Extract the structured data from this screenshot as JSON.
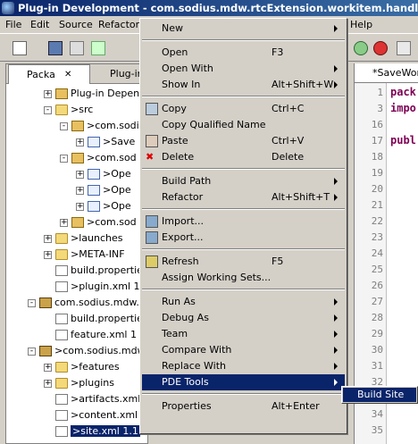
{
  "window": {
    "title": "Plug-in Development - com.sodius.mdw.rtcExtension.workitem.handler/src/com"
  },
  "menubar": [
    "File",
    "Edit",
    "Source",
    "Refactor",
    "Help"
  ],
  "explorer": {
    "tabs": [
      "Packa",
      "Plug-in"
    ],
    "tree": [
      {
        "label": "Plug-in Depen",
        "indent": 0,
        "icon": "pkg",
        "expander": "+"
      },
      {
        "label": ">src",
        "indent": 0,
        "icon": "folder",
        "expander": "-"
      },
      {
        "label": ">com.sodi",
        "indent": 1,
        "icon": "pkg",
        "expander": "-"
      },
      {
        "label": ">Save",
        "indent": 2,
        "icon": "java",
        "expander": "+"
      },
      {
        "label": ">com.sod",
        "indent": 1,
        "icon": "pkg",
        "expander": "-"
      },
      {
        "label": ">Ope",
        "indent": 2,
        "icon": "java",
        "expander": "+"
      },
      {
        "label": ">Ope",
        "indent": 2,
        "icon": "java",
        "expander": "+"
      },
      {
        "label": ">Ope",
        "indent": 2,
        "icon": "java",
        "expander": "+"
      },
      {
        "label": ">com.sod",
        "indent": 1,
        "icon": "pkg",
        "expander": "+"
      },
      {
        "label": ">launches",
        "indent": 0,
        "icon": "folder",
        "expander": "+"
      },
      {
        "label": ">META-INF",
        "indent": 0,
        "icon": "folder",
        "expander": "+"
      },
      {
        "label": "build.propertie",
        "indent": 0,
        "icon": "file",
        "expander": ""
      },
      {
        "label": ">plugin.xml  1",
        "indent": 0,
        "icon": "file",
        "expander": ""
      },
      {
        "label": "com.sodius.mdw.r",
        "indent": -1,
        "icon": "project",
        "expander": "-"
      },
      {
        "label": "build.propertie",
        "indent": 0,
        "icon": "file",
        "expander": ""
      },
      {
        "label": "feature.xml  1",
        "indent": 0,
        "icon": "file",
        "expander": ""
      },
      {
        "label": ">com.sodius.mdw",
        "indent": -1,
        "icon": "project",
        "expander": "-"
      },
      {
        "label": ">features",
        "indent": 0,
        "icon": "folder",
        "expander": "+"
      },
      {
        "label": ">plugins",
        "indent": 0,
        "icon": "folder",
        "expander": "+"
      },
      {
        "label": ">artifacts.xml",
        "indent": 0,
        "icon": "file",
        "expander": ""
      },
      {
        "label": ">content.xml",
        "indent": 0,
        "icon": "file",
        "expander": ""
      },
      {
        "label": ">site.xml  1.1",
        "indent": 0,
        "icon": "file",
        "expander": "",
        "selected": true
      }
    ]
  },
  "editor": {
    "tab": "*SaveWor",
    "lines": [
      {
        "no": "1",
        "code": "pack"
      },
      {
        "no": "3",
        "code": "impo"
      },
      {
        "no": "16",
        "code": ""
      },
      {
        "no": "17",
        "code": "publ"
      },
      {
        "no": "18",
        "code": ""
      },
      {
        "no": "19",
        "code": ""
      },
      {
        "no": "20",
        "code": ""
      },
      {
        "no": "21",
        "code": ""
      },
      {
        "no": "22",
        "code": ""
      },
      {
        "no": "23",
        "code": ""
      },
      {
        "no": "24",
        "code": ""
      },
      {
        "no": "25",
        "code": ""
      },
      {
        "no": "26",
        "code": ""
      },
      {
        "no": "27",
        "code": ""
      },
      {
        "no": "28",
        "code": ""
      },
      {
        "no": "29",
        "code": ""
      },
      {
        "no": "30",
        "code": ""
      },
      {
        "no": "31",
        "code": ""
      },
      {
        "no": "32",
        "code": ""
      },
      {
        "no": "33",
        "code": ""
      },
      {
        "no": "34",
        "code": ""
      },
      {
        "no": "35",
        "code": ""
      }
    ]
  },
  "context_menu": {
    "items": [
      {
        "label": "New",
        "key": "",
        "submenu": true
      },
      {
        "sep": true
      },
      {
        "label": "Open",
        "key": "F3"
      },
      {
        "label": "Open With",
        "key": "",
        "submenu": true
      },
      {
        "label": "Show In",
        "key": "Alt+Shift+W",
        "submenu": true
      },
      {
        "sep": true
      },
      {
        "label": "Copy",
        "key": "Ctrl+C",
        "icon": "copy-icon"
      },
      {
        "label": "Copy Qualified Name",
        "key": ""
      },
      {
        "label": "Paste",
        "key": "Ctrl+V",
        "icon": "paste-icon"
      },
      {
        "label": "Delete",
        "key": "Delete",
        "icon": "delete-icon"
      },
      {
        "sep": true
      },
      {
        "label": "Build Path",
        "key": "",
        "submenu": true
      },
      {
        "label": "Refactor",
        "key": "Alt+Shift+T",
        "submenu": true
      },
      {
        "sep": true
      },
      {
        "label": "Import...",
        "key": "",
        "icon": "import-icon"
      },
      {
        "label": "Export...",
        "key": "",
        "icon": "export-icon"
      },
      {
        "sep": true
      },
      {
        "label": "Refresh",
        "key": "F5",
        "icon": "refresh-icon"
      },
      {
        "label": "Assign Working Sets...",
        "key": ""
      },
      {
        "sep": true
      },
      {
        "label": "Run As",
        "key": "",
        "submenu": true
      },
      {
        "label": "Debug As",
        "key": "",
        "submenu": true
      },
      {
        "label": "Team",
        "key": "",
        "submenu": true
      },
      {
        "label": "Compare With",
        "key": "",
        "submenu": true
      },
      {
        "label": "Replace With",
        "key": "",
        "submenu": true
      },
      {
        "label": "PDE Tools",
        "key": "",
        "submenu": true,
        "highlighted": true
      },
      {
        "sep": true
      },
      {
        "label": "Properties",
        "key": "Alt+Enter"
      }
    ]
  },
  "submenu": {
    "label": "Build Site"
  },
  "colors": {
    "selection": "#0a246a",
    "menu_bg": "#d4d0c8",
    "title_gradient_start": "#0a246a",
    "title_gradient_end": "#3a6ea5"
  }
}
